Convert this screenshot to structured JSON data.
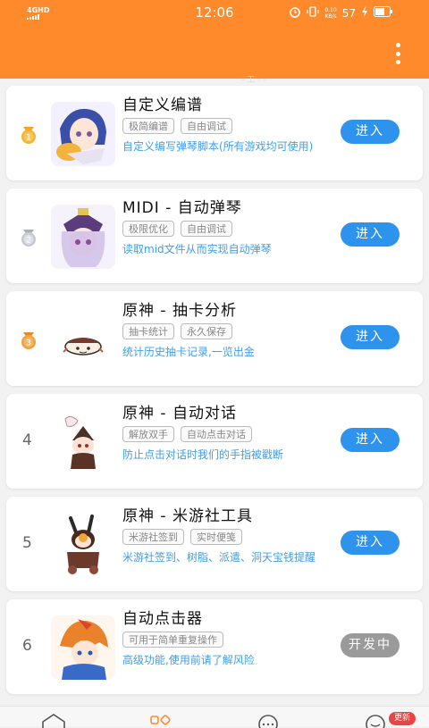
{
  "status_bar": {
    "network": "4GHD",
    "time": "12:06",
    "speed_value": "0.10",
    "speed_unit": "KB/s",
    "battery": "57"
  },
  "appbar": {
    "menu_icon": "more-vertical-icon",
    "faint_text": "- 工 - -"
  },
  "items": [
    {
      "rank": "1",
      "medal": "gold",
      "title": "自定义编谱",
      "tags": [
        "极简编谱",
        "自由调试"
      ],
      "desc": "自定义编写弹琴脚本(所有游戏均可使用)",
      "button": "进入"
    },
    {
      "rank": "2",
      "medal": "silver",
      "title": "MIDI - 自动弹琴",
      "tags": [
        "极限优化",
        "自由调试"
      ],
      "desc": "读取mid文件从而实现自动弹琴",
      "button": "进入"
    },
    {
      "rank": "3",
      "medal": "bronze",
      "title": "原神 - 抽卡分析",
      "tags": [
        "抽卡统计",
        "永久保存"
      ],
      "desc": "统计历史抽卡记录,一览出金",
      "button": "进入"
    },
    {
      "rank": "4",
      "medal": "",
      "title": "原神 - 自动对话",
      "tags": [
        "解放双手",
        "自动点击对话"
      ],
      "desc": "防止点击对话时我们的手指被戳断",
      "button": "进入"
    },
    {
      "rank": "5",
      "medal": "",
      "title": "原神 - 米游社工具",
      "tags": [
        "米游社签到",
        "实时便笺"
      ],
      "desc": "米游社签到、树脂、派遣、洞天宝钱提醒",
      "button": "进入"
    },
    {
      "rank": "6",
      "medal": "",
      "title": "自动点击器",
      "tags": [
        "可用于简单重复操作"
      ],
      "desc": "高级功能,使用前请了解风险",
      "button": "开发中"
    }
  ],
  "bottom_nav": {
    "icons": [
      "home-icon",
      "apps-icon",
      "chat-icon",
      "profile-icon"
    ],
    "active_color": "#ff8a2b",
    "badge": "更新"
  },
  "colors": {
    "accent": "#ff8a2b",
    "button": "#2e93ec",
    "disabled": "#9a9a9a",
    "desc": "#3f9fe8"
  }
}
